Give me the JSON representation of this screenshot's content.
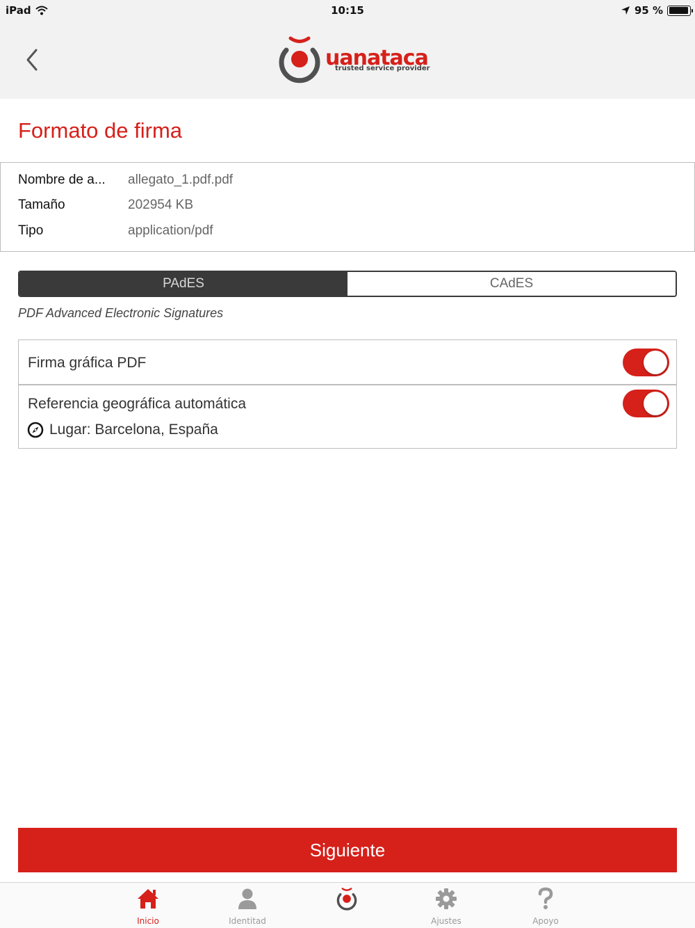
{
  "status_bar": {
    "device": "iPad",
    "time": "10:15",
    "battery": "95 %",
    "battery_level": 0.95
  },
  "header": {
    "logo_name": "uanataca",
    "logo_tagline": "trusted service provider"
  },
  "page": {
    "title": "Formato de firma"
  },
  "file_info": [
    {
      "label": "Nombre de a...",
      "value": "allegato_1.pdf.pdf"
    },
    {
      "label": "Tamaño",
      "value": "202954 KB"
    },
    {
      "label": "Tipo",
      "value": "application/pdf"
    }
  ],
  "format_selector": {
    "options": [
      "PAdES",
      "CAdES"
    ],
    "selected": "PAdES",
    "description": "PDF Advanced Electronic Signatures"
  },
  "options": {
    "graphic_signature": {
      "label": "Firma gráfica PDF",
      "enabled": true
    },
    "geo_reference": {
      "label": "Referencia geográfica automática",
      "enabled": true,
      "place": "Lugar: Barcelona, España"
    }
  },
  "next_button": {
    "label": "Siguiente"
  },
  "tab_bar": {
    "tabs": [
      {
        "label": "Inicio",
        "icon": "home-icon",
        "active": true
      },
      {
        "label": "Identitad",
        "icon": "person-icon",
        "active": false
      },
      {
        "label": "",
        "icon": "uanataca-logo-icon",
        "active": false
      },
      {
        "label": "Ajustes",
        "icon": "gear-icon",
        "active": false
      },
      {
        "label": "Apoyo",
        "icon": "question-icon",
        "active": false
      }
    ]
  },
  "colors": {
    "accent": "#d6201a",
    "header_bg": "#f2f2f2",
    "segment_dark": "#3a3a3a"
  }
}
